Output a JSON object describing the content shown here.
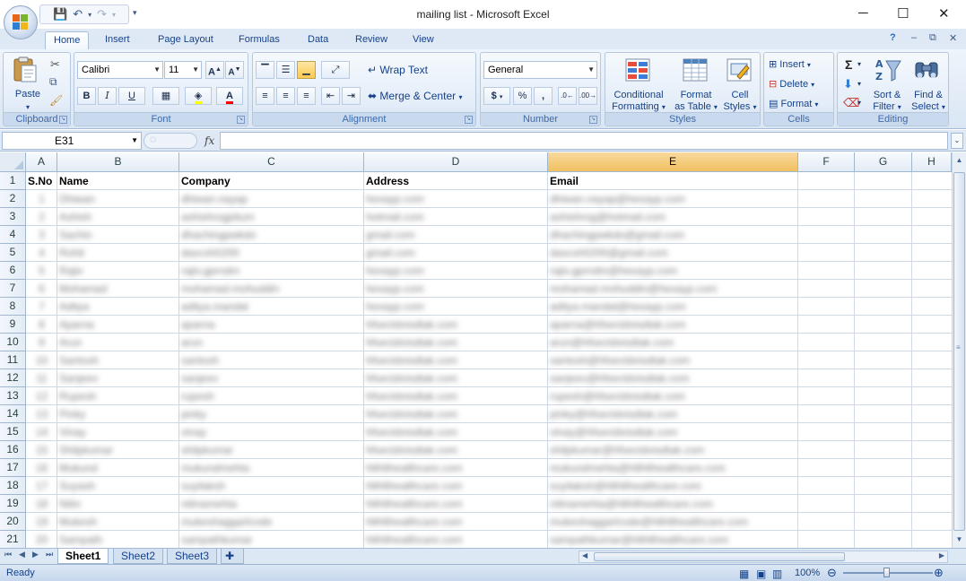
{
  "window": {
    "title": "mailing list - Microsoft Excel",
    "minimize": "─",
    "maximize": "☐",
    "close": "✕"
  },
  "ribbon_tabs": [
    "Home",
    "Insert",
    "Page Layout",
    "Formulas",
    "Data",
    "Review",
    "View"
  ],
  "ribbon": {
    "clipboard": {
      "label": "Clipboard",
      "paste": "Paste"
    },
    "font": {
      "label": "Font",
      "name": "Calibri",
      "size": "11",
      "bold": "B",
      "italic": "I",
      "underline": "U"
    },
    "alignment": {
      "label": "Alignment",
      "wrap_text": "Wrap Text",
      "merge_center": "Merge & Center"
    },
    "number": {
      "label": "Number",
      "format": "General",
      "currency": "$",
      "percent": "%",
      "comma": ","
    },
    "styles": {
      "label": "Styles",
      "conditional": "Conditional",
      "formatting": "Formatting",
      "format": "Format",
      "as_table": "as Table",
      "cell": "Cell",
      "cell_styles": "Styles"
    },
    "cells": {
      "label": "Cells",
      "insert": "Insert",
      "delete": "Delete",
      "format": "Format"
    },
    "editing": {
      "label": "Editing",
      "sort": "Sort &",
      "filter": "Filter",
      "find": "Find &",
      "select": "Select"
    }
  },
  "formula_bar": {
    "name_box": "E31",
    "fx": "fx",
    "value": ""
  },
  "columns": [
    "A",
    "B",
    "C",
    "D",
    "E",
    "F",
    "G",
    "H"
  ],
  "selected_column": "E",
  "header_row": [
    "S.No",
    "Name",
    "Company",
    "Address",
    "Email"
  ],
  "rows": [
    [
      "1",
      "Dhiwan",
      "dhiwan.nayap",
      "hexayp.com",
      "dhiwan.nayap@hexayp.com"
    ],
    [
      "2",
      "Ashish",
      "ashishrogpitum",
      "hotmail.com",
      "ashishrog@hotmail.com"
    ],
    [
      "3",
      "Sachin",
      "dhachingpwkdo",
      "gmail.com",
      "dhachingpwkdo@gmail.com"
    ],
    [
      "4",
      "Rohit",
      "dascsh0200",
      "gmail.com",
      "dascsh0200@gmail.com"
    ],
    [
      "5",
      "Rajiv",
      "rajiv.gprndm",
      "hexayp.com",
      "rajiv.gprndm@hexayp.com"
    ],
    [
      "6",
      "Mohamad",
      "mohamad.mohuddin",
      "hexayp.com",
      "mohamad.mohuddin@hexayp.com"
    ],
    [
      "7",
      "Aditya",
      "aditya.mandal",
      "hexayp.com",
      "aditya.mandal@hexayp.com"
    ],
    [
      "8",
      "Aparna",
      "aparna",
      "hfsectdvisdtak.com",
      "aparna@hfsectdvisdtak.com"
    ],
    [
      "9",
      "Arun",
      "arun",
      "hfsectdvisdtak.com",
      "arun@hfsectdvisdtak.com"
    ],
    [
      "10",
      "Santosh",
      "santosh",
      "hfsectdvisdtak.com",
      "santosh@hfsectdvisdtak.com"
    ],
    [
      "11",
      "Sanjeev",
      "sanjeev",
      "hfsectdvisdtak.com",
      "sanjeev@hfsectdvisdtak.com"
    ],
    [
      "12",
      "Rupesh",
      "rupesh",
      "hfsectdvisdtak.com",
      "rupesh@hfsectdvisdtak.com"
    ],
    [
      "13",
      "Pinky",
      "pinky",
      "hfsectdvisdtak.com",
      "pinky@hfsectdvisdtak.com"
    ],
    [
      "14",
      "Vinay",
      "vinay",
      "hfsectdvisdtak.com",
      "vinay@hfsectdvisdtak.com"
    ],
    [
      "15",
      "Shilpkumar",
      "shilpkumar",
      "hfsectdvisdtak.com",
      "shilpkumar@hfsectdvisdtak.com"
    ],
    [
      "16",
      "Mukund",
      "mukundmehta",
      "hlthlthealthcare.com",
      "mukundmehta@hlthlthealthcare.com"
    ],
    [
      "17",
      "Suyash",
      "suyilaksh",
      "hlthlthealthcare.com",
      "suyilaksh@hlthlthealthcare.com"
    ],
    [
      "18",
      "Nitin",
      "nitinamehta",
      "hlthlthealthcare.com",
      "nitinamehta@hlthlthealthcare.com"
    ],
    [
      "19",
      "Mukesh",
      "mukeshaggarlcode",
      "hlthlthealthcare.com",
      "mukeshaggarlcode@hlthlthealthcare.com"
    ],
    [
      "20",
      "Sampath",
      "sampathkumar",
      "hlthlthealthcare.com",
      "sampathkumar@hlthlthealthcare.com"
    ]
  ],
  "row_numbers": [
    "1",
    "2",
    "3",
    "4",
    "5",
    "6",
    "7",
    "8",
    "9",
    "10",
    "11",
    "12",
    "13",
    "14",
    "15",
    "16",
    "17",
    "18",
    "19",
    "20",
    "21"
  ],
  "sheets": [
    "Sheet1",
    "Sheet2",
    "Sheet3"
  ],
  "active_sheet": "Sheet1",
  "status": {
    "ready": "Ready",
    "zoom": "100%"
  }
}
